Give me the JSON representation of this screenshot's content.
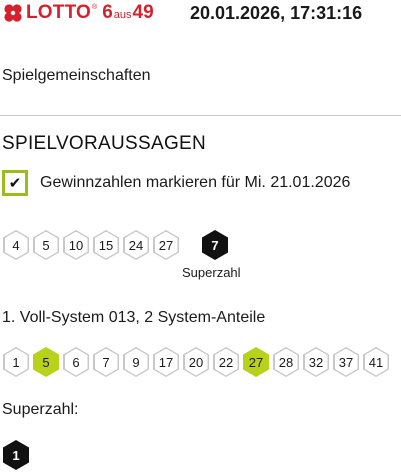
{
  "header": {
    "logo": {
      "lotto": "LOTTO",
      "reg": "®",
      "six": "6",
      "aus": "aus",
      "fortynine": "49"
    },
    "datetime": "20.01.2026, 17:31:16"
  },
  "nav": {
    "link": "Spielgemeinschaften"
  },
  "section": {
    "title": "SPIELVORAUSSAGEN"
  },
  "checkbox": {
    "checked": true,
    "mark": "✔",
    "label": "Gewinnzahlen markieren für Mi. 21.01.2026"
  },
  "prediction": {
    "numbers": [
      "4",
      "5",
      "10",
      "15",
      "24",
      "27"
    ],
    "superzahl": "7",
    "superzahl_label": "Superzahl"
  },
  "system": {
    "title": "1. Voll-System 013, 2 System-Anteile",
    "numbers": [
      {
        "value": "1",
        "hit": false
      },
      {
        "value": "5",
        "hit": true
      },
      {
        "value": "6",
        "hit": false
      },
      {
        "value": "7",
        "hit": false
      },
      {
        "value": "9",
        "hit": false
      },
      {
        "value": "17",
        "hit": false
      },
      {
        "value": "20",
        "hit": false
      },
      {
        "value": "22",
        "hit": false
      },
      {
        "value": "27",
        "hit": true
      },
      {
        "value": "28",
        "hit": false
      },
      {
        "value": "32",
        "hit": false
      },
      {
        "value": "37",
        "hit": false
      },
      {
        "value": "41",
        "hit": false
      }
    ],
    "superzahl_title": "Superzahl:",
    "superzahl": "1"
  },
  "colors": {
    "brand_red": "#d6212d",
    "hit_green": "#b8d11a",
    "checkbox_border": "#9bbd1a"
  }
}
